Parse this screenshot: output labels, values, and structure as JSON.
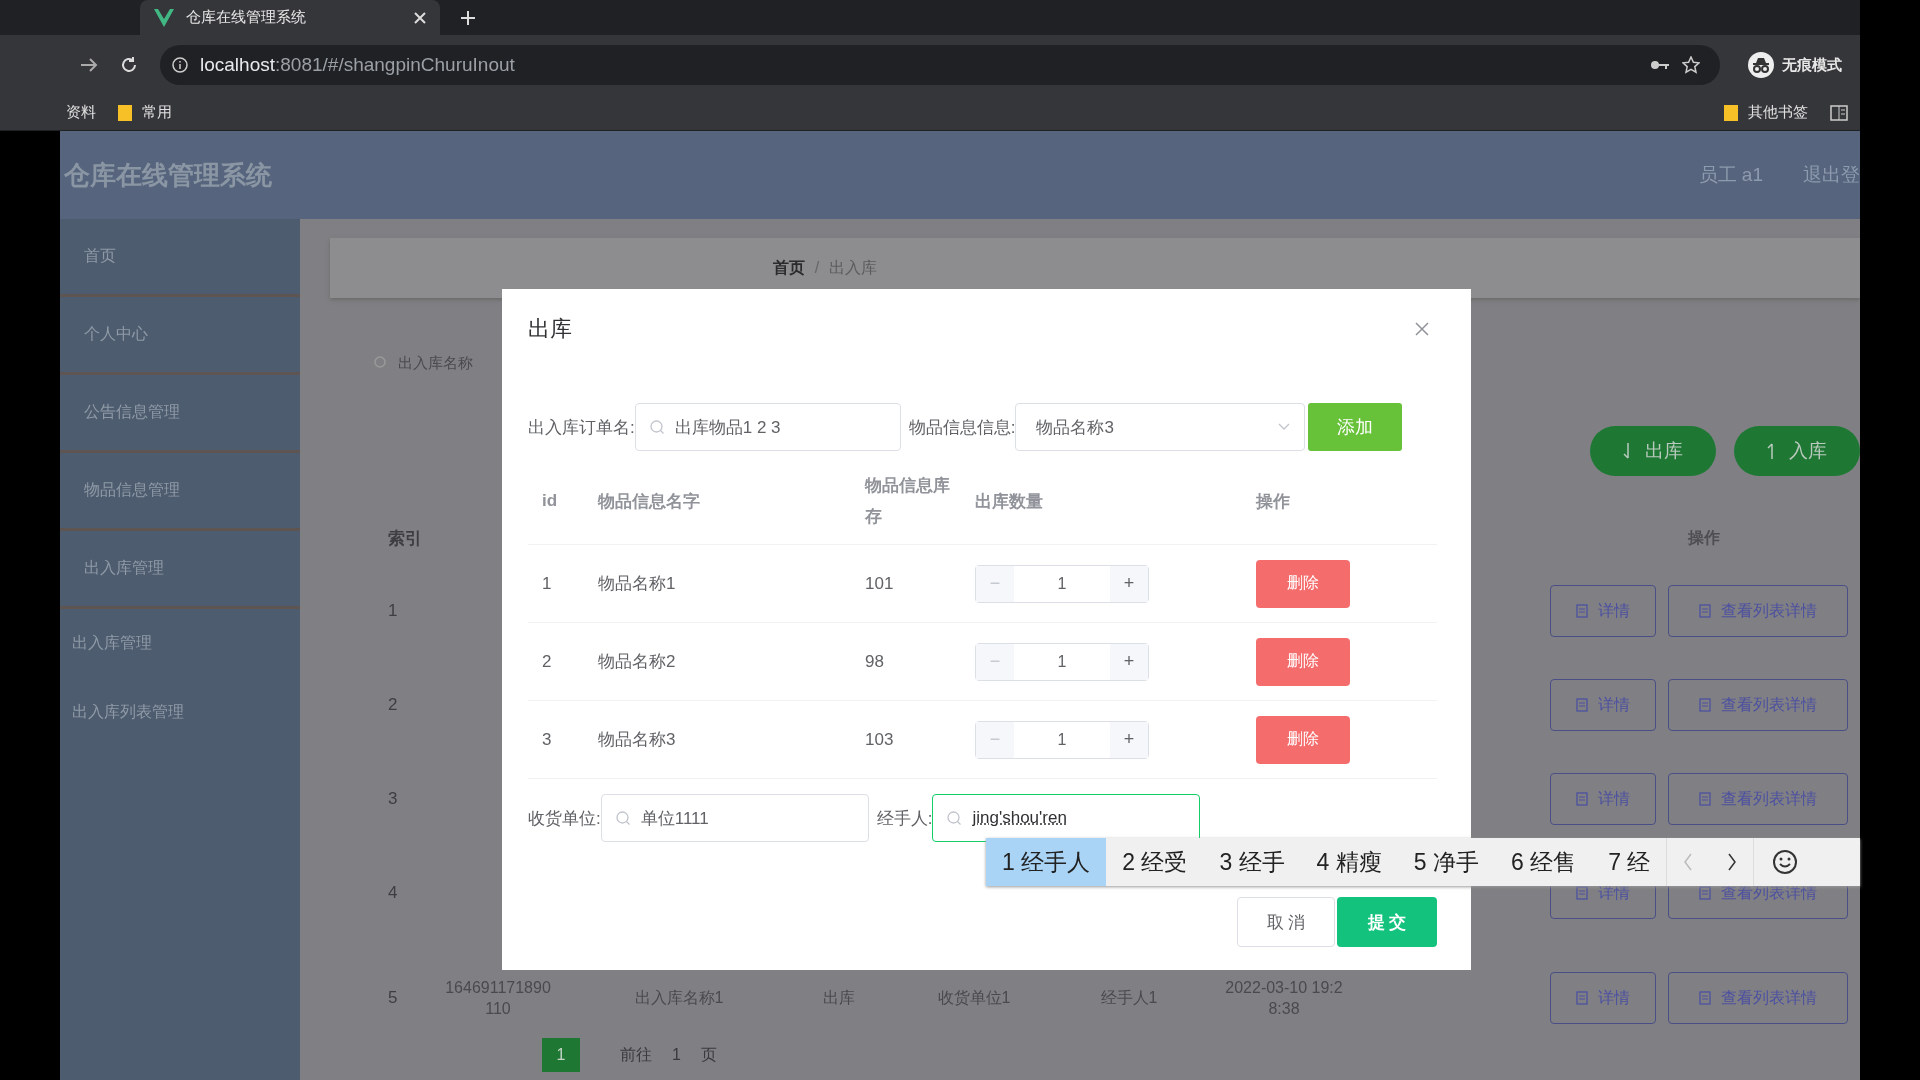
{
  "browser": {
    "tab_title": "仓库在线管理系统",
    "url_host": "localhost",
    "url_path": ":8081/#/shangpinChuruInout",
    "incognito_label": "无痕模式",
    "bookmarks": [
      "资料",
      "常用"
    ],
    "other_bookmarks": "其他书签"
  },
  "app": {
    "title": "仓库在线管理系统",
    "user": "员工 a1",
    "logout": "退出登"
  },
  "sidebar": {
    "items": [
      {
        "label": "首页"
      },
      {
        "label": "个人中心"
      },
      {
        "label": "公告信息管理"
      },
      {
        "label": "物品信息管理"
      },
      {
        "label": "出入库管理",
        "children": [
          {
            "label": "出入库管理"
          },
          {
            "label": "出入库列表管理"
          }
        ]
      }
    ]
  },
  "breadcrumb": {
    "items": [
      "首页",
      "出入库"
    ],
    "separator": "/"
  },
  "search": {
    "placeholder": "出入库名称"
  },
  "toolbar": [
    {
      "label": "出库",
      "kind": "out"
    },
    {
      "label": "入库",
      "kind": "in"
    }
  ],
  "table": {
    "index_header": "索引",
    "action_header": "操作",
    "rows": [
      {
        "index": "1",
        "actions": [
          "详情",
          "查看列表详情"
        ]
      },
      {
        "index": "2",
        "actions": [
          "详情",
          "查看列表详情"
        ]
      },
      {
        "index": "3",
        "actions": [
          "详情",
          "查看列表详情"
        ]
      },
      {
        "index": "4",
        "actions": [
          "详情",
          "查看列表详情"
        ]
      },
      {
        "index": "5",
        "cells": [
          "164691171890110",
          "出入库名称1",
          "出库",
          "收货单位1",
          "经手人1",
          "2022-03-10 19:28:38"
        ],
        "actions": [
          "详情",
          "查看列表详情"
        ]
      }
    ]
  },
  "pagination": {
    "current": "1",
    "goto_label": "前往",
    "goto_value": "1",
    "unit": "页"
  },
  "dialog": {
    "title": "出库",
    "order_label": "出入库订单名:",
    "order_value": "出库物品1 2 3",
    "item_label": "物品信息信息:",
    "item_value": "物品名称3",
    "add_button": "添加",
    "columns": [
      "id",
      "物品信息名字",
      "物品信息库存",
      "出库数量",
      "操作"
    ],
    "items": [
      {
        "id": "1",
        "name": "物品名称1",
        "stock": "101",
        "qty": "1",
        "action": "删除"
      },
      {
        "id": "2",
        "name": "物品名称2",
        "stock": "98",
        "qty": "1",
        "action": "删除"
      },
      {
        "id": "3",
        "name": "物品名称3",
        "stock": "103",
        "qty": "1",
        "action": "删除"
      }
    ],
    "decrement": "−",
    "increment": "+",
    "receiver_label": "收货单位:",
    "receiver_value": "单位1111",
    "handler_label": "经手人:",
    "handler_value": "jing'shou'ren",
    "cancel": "取 消",
    "submit": "提 交"
  },
  "ime": {
    "candidates": [
      {
        "label": "1 经手人",
        "selected": true
      },
      {
        "label": "2 经受",
        "selected": false
      },
      {
        "label": "3 经手",
        "selected": false
      },
      {
        "label": "4 精瘦",
        "selected": false
      },
      {
        "label": "5 净手",
        "selected": false
      },
      {
        "label": "6 经售",
        "selected": false
      },
      {
        "label": "7 经",
        "selected": false
      }
    ]
  }
}
